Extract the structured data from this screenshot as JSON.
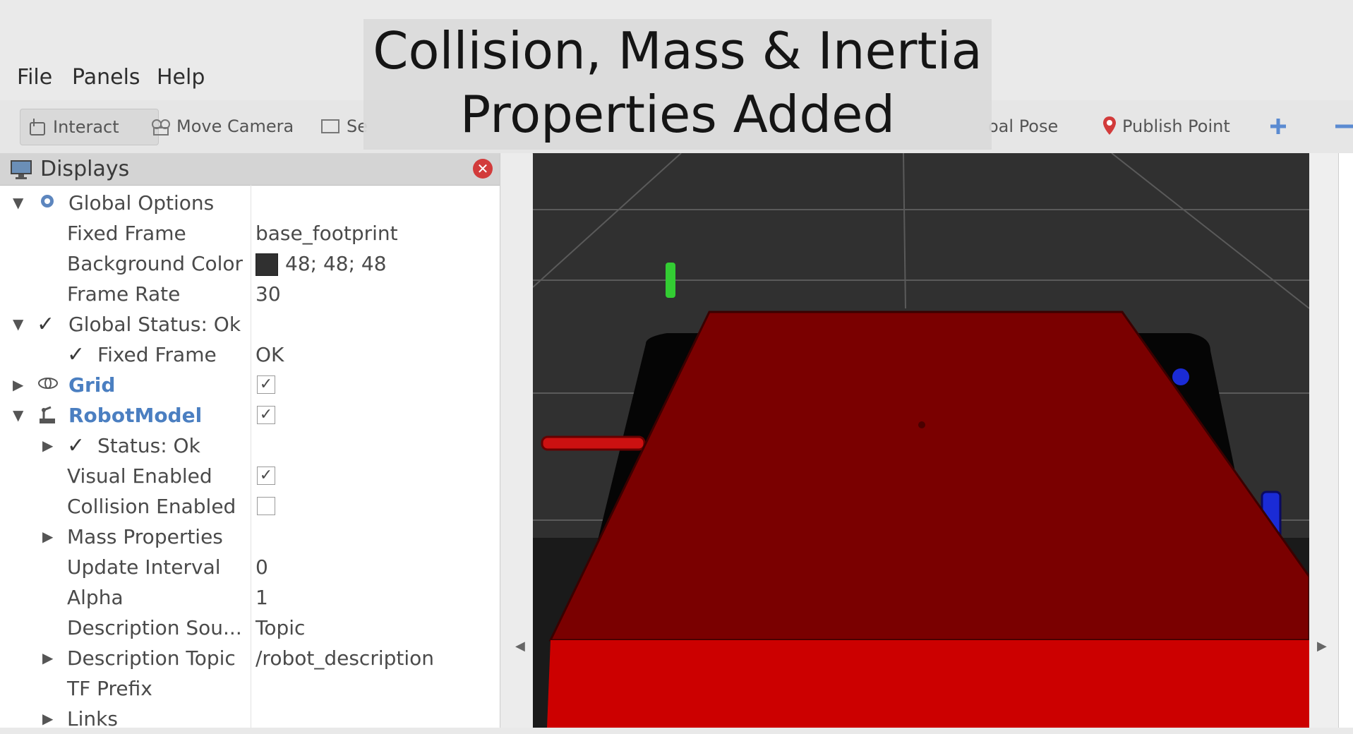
{
  "overlay": {
    "line1": "Collision, Mass & Inertia",
    "line2": "Properties Added"
  },
  "menu": {
    "file": "File",
    "panels": "Panels",
    "help": "Help"
  },
  "toolbar": {
    "interact": "Interact",
    "move_camera": "Move Camera",
    "select_partial": "Se",
    "goal_pose_partial": "oal Pose",
    "publish_point": "Publish Point"
  },
  "displays": {
    "title": "Displays",
    "rows": [
      {
        "name": "Global Options",
        "value": ""
      },
      {
        "name": "Fixed Frame",
        "value": "base_footprint"
      },
      {
        "name": "Background Color",
        "value": "48; 48; 48"
      },
      {
        "name": "Frame Rate",
        "value": "30"
      },
      {
        "name": "Global Status: Ok",
        "value": ""
      },
      {
        "name": "Fixed Frame",
        "value": "OK"
      },
      {
        "name": "Grid",
        "value": true
      },
      {
        "name": "RobotModel",
        "value": true
      },
      {
        "name": "Status: Ok",
        "value": ""
      },
      {
        "name": "Visual Enabled",
        "value": true
      },
      {
        "name": "Collision Enabled",
        "value": false
      },
      {
        "name": "Mass Properties",
        "value": ""
      },
      {
        "name": "Update Interval",
        "value": "0"
      },
      {
        "name": "Alpha",
        "value": "1"
      },
      {
        "name": "Description Sou...",
        "value": "Topic"
      },
      {
        "name": "Description Topic",
        "value": "/robot_description"
      },
      {
        "name": "TF Prefix",
        "value": ""
      },
      {
        "name": "Links",
        "value": ""
      }
    ]
  },
  "colors": {
    "background": "#303030",
    "robot_body": "#7a0000",
    "robot_front": "#cc0000",
    "accent_blue": "#4b7fc1"
  }
}
